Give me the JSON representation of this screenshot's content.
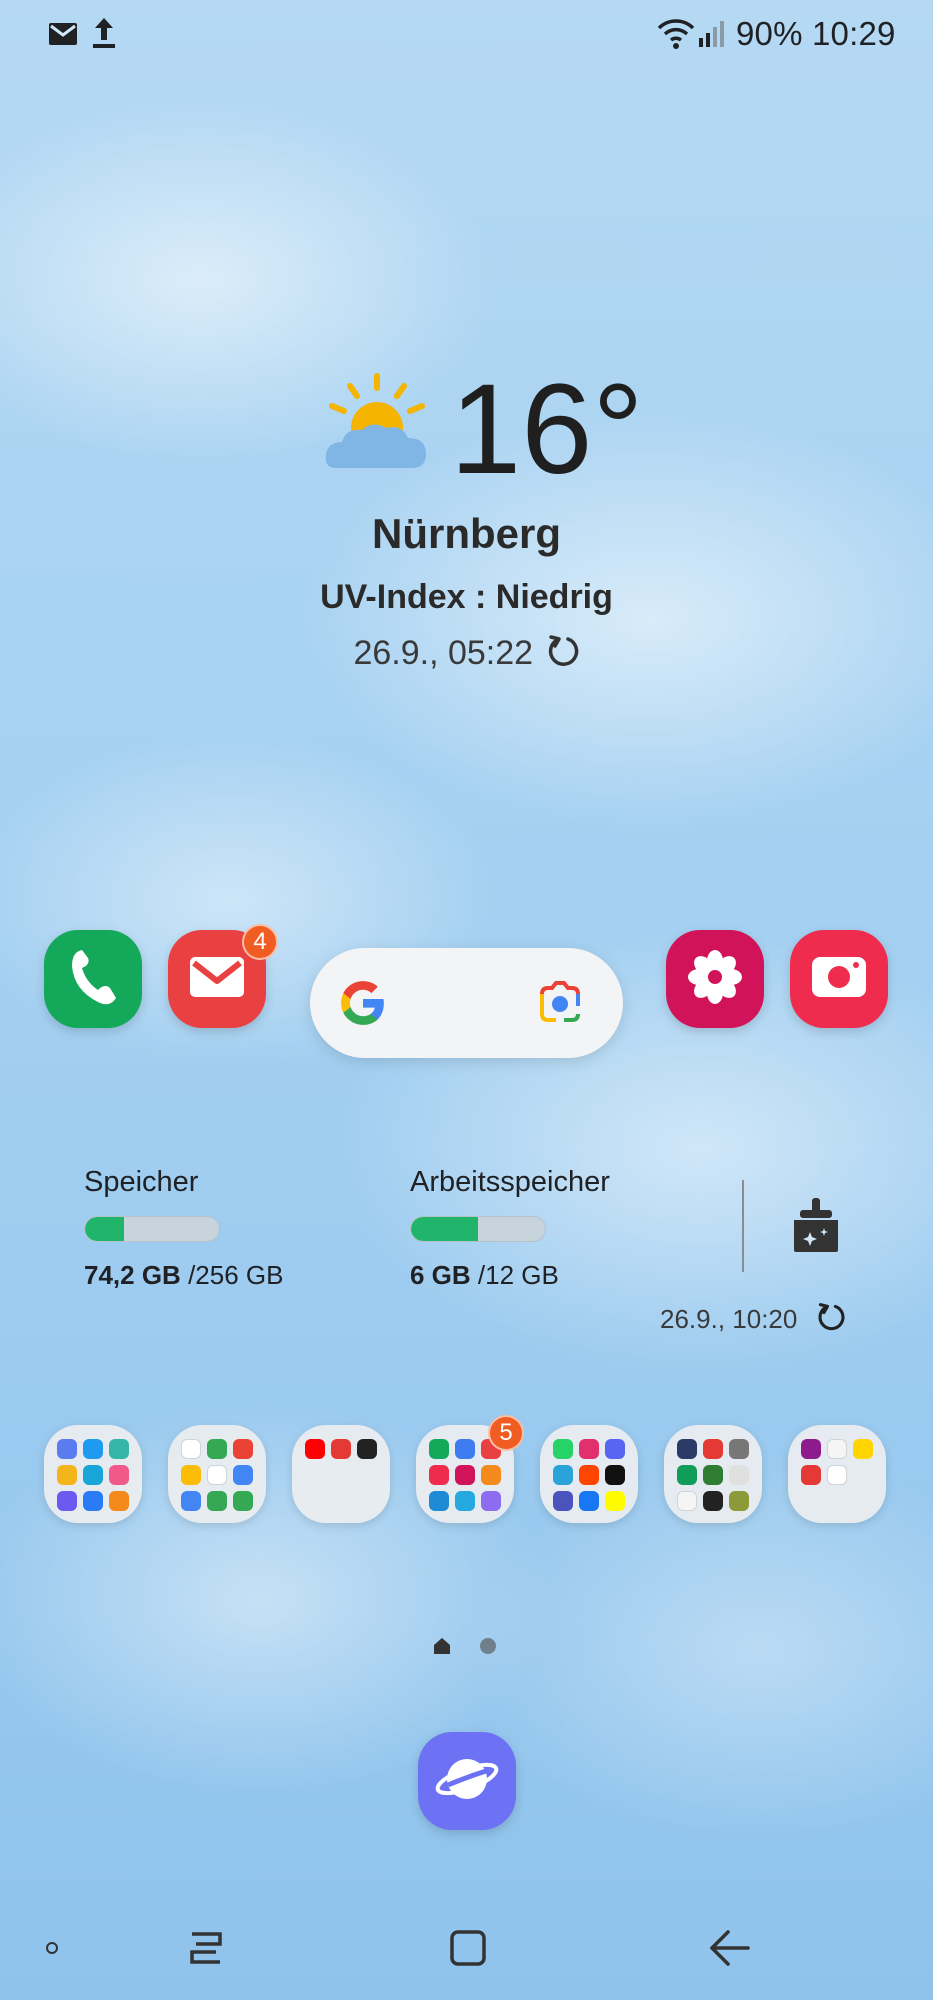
{
  "status_bar": {
    "left_icons": [
      "mail-icon",
      "upload-icon"
    ],
    "right_icons": [
      "wifi-icon",
      "signal-icon"
    ],
    "battery": "90%",
    "time": "10:29"
  },
  "weather": {
    "icon": "partly-sunny-icon",
    "temperature": "16°",
    "city": "Nürnberg",
    "uv_index": "UV-Index : Niedrig",
    "updated": "26.9., 05:22"
  },
  "dock_row": {
    "apps": [
      {
        "name": "phone",
        "icon": "phone-icon",
        "color": "#14a85a"
      },
      {
        "name": "email",
        "icon": "mail-icon",
        "color": "#e94141",
        "badge": "4"
      },
      {
        "name": "gallery",
        "icon": "flower-icon",
        "color": "#d1145a"
      },
      {
        "name": "camera",
        "icon": "camera-icon",
        "color": "#ef2c4e"
      }
    ],
    "search": {
      "left_icon": "google-g-icon",
      "right_icon": "google-lens-icon"
    }
  },
  "device_care": {
    "storage_label": "Speicher",
    "storage_used": "74,2 GB",
    "storage_total": "/256 GB",
    "storage_fraction": 0.29,
    "ram_label": "Arbeitsspeicher",
    "ram_used": "6 GB",
    "ram_total": "/12 GB",
    "ram_fraction": 0.5,
    "clean_icon": "broom-sparkle-icon",
    "updated": "26.9., 10:20"
  },
  "folders": [
    {
      "name": "folder-1",
      "minis": [
        "#5b7cf0",
        "#1e9bf0",
        "#36b6a7",
        "#f3b51b",
        "#18a6d9",
        "#f05a8a",
        "#6a5af0",
        "#2a7cf6",
        "#f38a1b"
      ]
    },
    {
      "name": "folder-2",
      "minis": [
        "#ffffff",
        "#34a853",
        "#ea4335",
        "#fbbc05",
        "#ffffff",
        "#4285f4",
        "#4285f4",
        "#34a853",
        "#34a853"
      ]
    },
    {
      "name": "folder-3",
      "minis": [
        "#ff0000",
        "#e53935",
        "#222222"
      ]
    },
    {
      "name": "folder-4",
      "badge": "5",
      "minis": [
        "#14a85a",
        "#3d7df0",
        "#e94141",
        "#ef2c4e",
        "#d1145a",
        "#f38a1b",
        "#1f8bd6",
        "#23a8e0",
        "#8e6cf0"
      ]
    },
    {
      "name": "folder-5",
      "minis": [
        "#25d366",
        "#e1306c",
        "#5865f2",
        "#2aa3d8",
        "#ff4500",
        "#111111",
        "#4b53bc",
        "#1877f2",
        "#fffc00"
      ]
    },
    {
      "name": "folder-6",
      "minis": [
        "#2b3a67",
        "#e53935",
        "#777777",
        "#0f9d58",
        "#2e7d32",
        "#e0e0e0",
        "#f5f5f5",
        "#222222",
        "#8d9a3a"
      ]
    },
    {
      "name": "folder-7",
      "minis": [
        "#8e1b8e",
        "#f5f5f5",
        "#ffd400",
        "#e53935",
        "#ffffff"
      ]
    }
  ],
  "page_indicator": {
    "pages": 2,
    "current": 1
  },
  "dock": {
    "browser_icon": "internet-planet-icon",
    "browser_color": "#6d72f5"
  },
  "nav_bar": {
    "icons": [
      "dot-indicator-icon",
      "recents-icon",
      "home-icon",
      "back-icon"
    ]
  }
}
